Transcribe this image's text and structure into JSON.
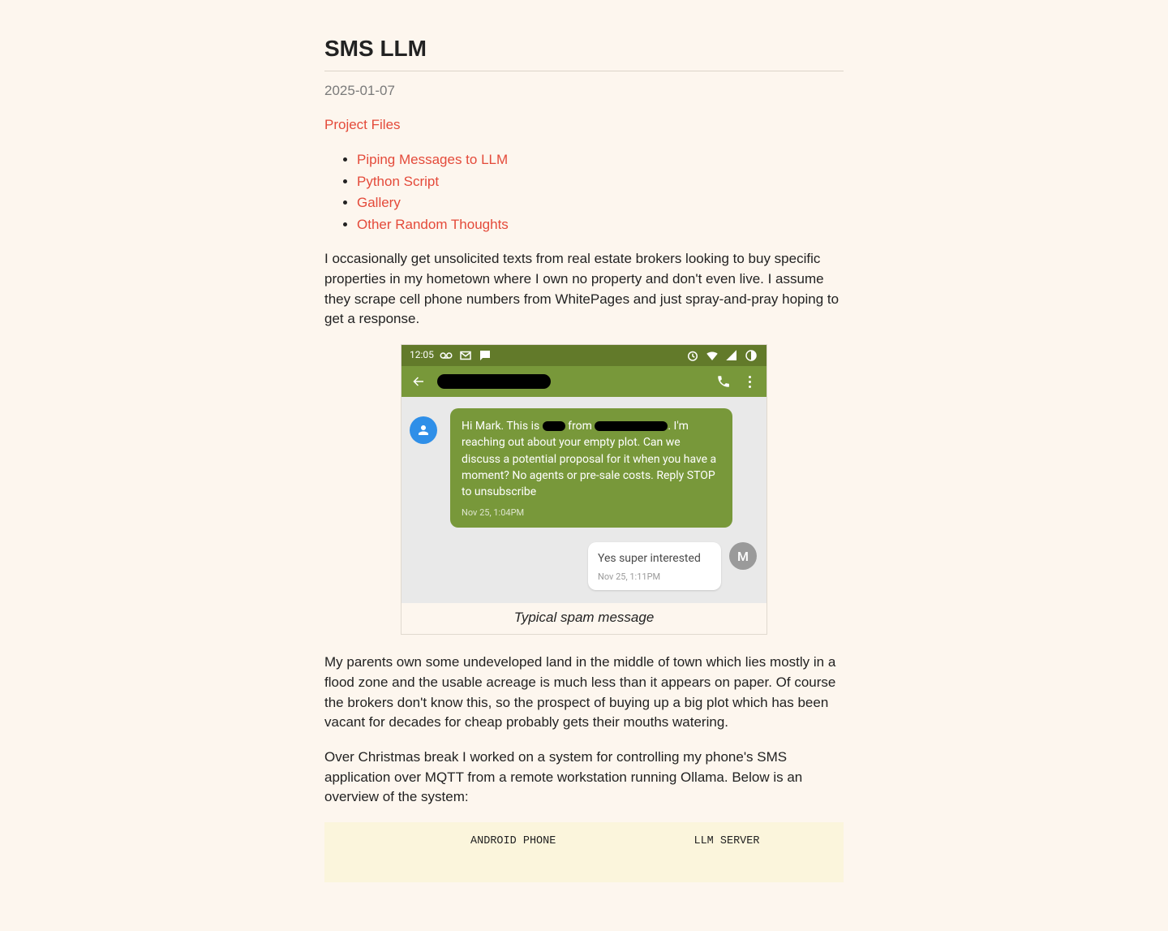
{
  "title": "SMS LLM",
  "date": "2025-01-07",
  "links": {
    "project_files": "Project Files"
  },
  "toc": [
    "Piping Messages to LLM",
    "Python Script",
    "Gallery",
    "Other Random Thoughts"
  ],
  "para1": "I occasionally get unsolicited texts from real estate brokers looking to buy specific properties in my hometown where I own no property and don't even live. I assume they scrape cell phone numbers from WhitePages and just spray-and-pray hoping to get a response.",
  "figure": {
    "caption": "Typical spam message",
    "statusbar_time": "12:05",
    "incoming_prefix": "Hi Mark. This is ",
    "incoming_mid": " from ",
    "incoming_rest": ". I'm reaching out about your empty plot. Can we discuss a potential proposal for it when you have a moment? No agents or pre-sale costs.       Reply STOP to unsubscribe",
    "incoming_ts": "Nov 25, 1:04PM",
    "outgoing_text": "Yes super interested",
    "outgoing_ts": "Nov 25, 1:11PM",
    "outgoing_initial": "M"
  },
  "para2": "My parents own some undeveloped land in the middle of town which lies mostly in a flood zone and the usable acreage is much less than it appears on paper. Of course the brokers don't know this, so the prospect of buying up a big plot which has been vacant for decades for cheap probably gets their mouths watering.",
  "para3": "Over Christmas break I worked on a system for controlling my phone's SMS application over MQTT from a remote workstation running Ollama. Below is an overview of the system:",
  "diagram_line1": "                    ANDROID PHONE                     LLM SERVER"
}
